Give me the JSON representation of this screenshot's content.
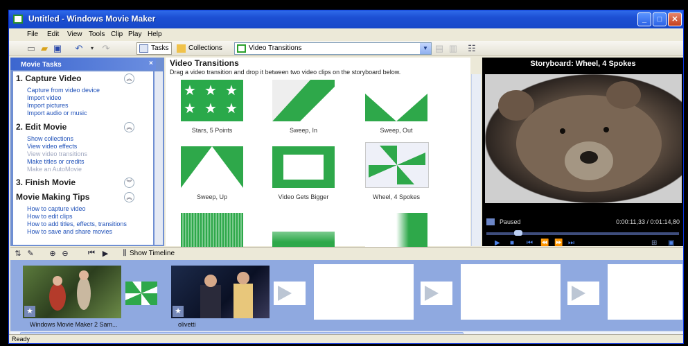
{
  "window": {
    "title": "Untitled - Windows Movie Maker"
  },
  "menu": [
    "File",
    "Edit",
    "View",
    "Tools",
    "Clip",
    "Play",
    "Help"
  ],
  "toolbar": {
    "tasks_label": "Tasks",
    "collections_label": "Collections",
    "collection_value": "Video Transitions"
  },
  "taskpane": {
    "header": "Movie Tasks",
    "close": "×",
    "sections": [
      {
        "title": "1. Capture Video",
        "items": [
          {
            "label": "Capture from video device",
            "enabled": true
          },
          {
            "label": "Import video",
            "enabled": true
          },
          {
            "label": "Import pictures",
            "enabled": true
          },
          {
            "label": "Import audio or music",
            "enabled": true
          }
        ]
      },
      {
        "title": "2. Edit Movie",
        "items": [
          {
            "label": "Show collections",
            "enabled": true
          },
          {
            "label": "View video effects",
            "enabled": true
          },
          {
            "label": "View video transitions",
            "enabled": false
          },
          {
            "label": "Make titles or credits",
            "enabled": true
          },
          {
            "label": "Make an AutoMovie",
            "enabled": false
          }
        ]
      },
      {
        "title": "3. Finish Movie",
        "items": []
      },
      {
        "title": "Movie Making Tips",
        "items": [
          {
            "label": "How to capture video",
            "enabled": true
          },
          {
            "label": "How to edit clips",
            "enabled": true
          },
          {
            "label": "How to add titles, effects, transitions",
            "enabled": true
          },
          {
            "label": "How to save and share movies",
            "enabled": true
          }
        ]
      }
    ]
  },
  "transitions": {
    "title": "Video Transitions",
    "subtitle": "Drag a video transition and drop it between two video clips on the storyboard below.",
    "items": [
      "Stars, 5 Points",
      "Sweep, In",
      "Sweep, Out",
      "Sweep, Up",
      "Video Gets Bigger",
      "Wheel, 4 Spokes"
    ]
  },
  "preview": {
    "title": "Storyboard: Wheel, 4 Spokes",
    "status": "Paused",
    "time": "0:00:11,33 / 0:01:14,80",
    "position": 0.15
  },
  "storyboard": {
    "show_timeline": "Show Timeline",
    "clips": [
      "Windows Movie Maker 2 Sam...",
      "olivetti"
    ]
  },
  "statusbar": {
    "text": "Ready"
  }
}
